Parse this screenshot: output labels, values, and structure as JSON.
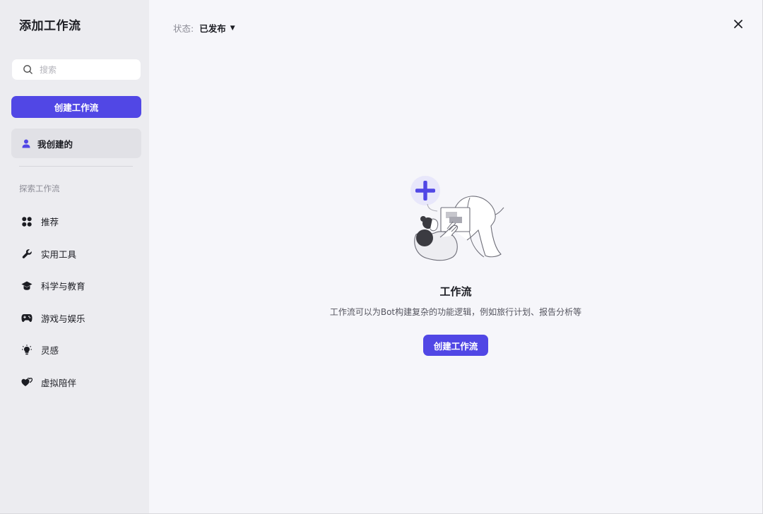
{
  "sidebar": {
    "title": "添加工作流",
    "search_placeholder": "搜索",
    "create_button": "创建工作流",
    "my_created": "我创建的",
    "section_label": "探索工作流",
    "categories": [
      {
        "label": "推荐",
        "icon": "grid-icon"
      },
      {
        "label": "实用工具",
        "icon": "wrench-icon"
      },
      {
        "label": "科学与教育",
        "icon": "graduation-cap-icon"
      },
      {
        "label": "游戏与娱乐",
        "icon": "gamepad-icon"
      },
      {
        "label": "灵感",
        "icon": "lightbulb-icon"
      },
      {
        "label": "虚拟陪伴",
        "icon": "hearts-icon"
      }
    ]
  },
  "main": {
    "status_label": "状态:",
    "status_value": "已发布",
    "empty_title": "工作流",
    "empty_description": "工作流可以为Bot构建复杂的功能逻辑，例如旅行计划、报告分析等",
    "create_button": "创建工作流"
  },
  "colors": {
    "accent": "#5147e5",
    "sidebar_bg": "#ececf0",
    "main_bg": "#f6f6fa"
  }
}
